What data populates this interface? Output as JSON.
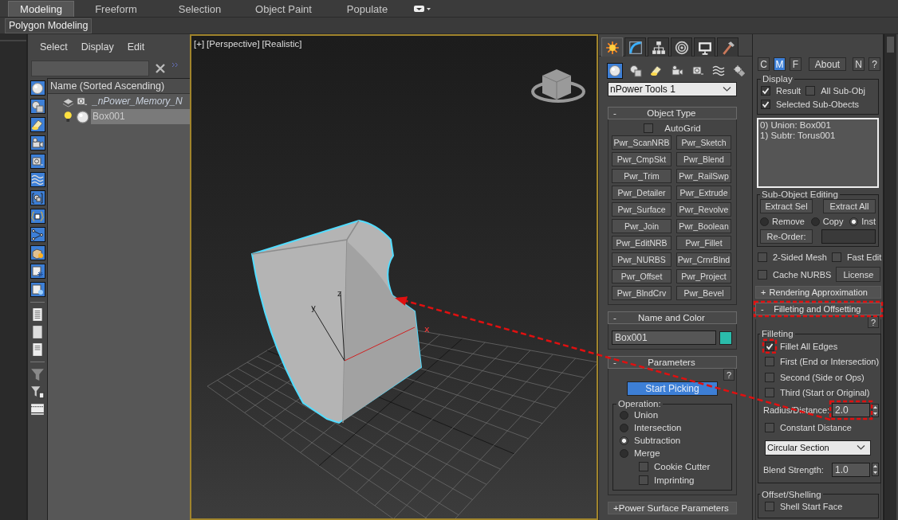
{
  "ribbon": {
    "tabs": [
      {
        "label": "Modeling",
        "selected": true
      },
      {
        "label": "Freeform",
        "selected": false
      },
      {
        "label": "Selection",
        "selected": false
      },
      {
        "label": "Object Paint",
        "selected": false
      },
      {
        "label": "Populate",
        "selected": false
      }
    ],
    "panel": "Polygon Modeling"
  },
  "scene_explorer": {
    "menus": [
      "Select",
      "Display",
      "Edit"
    ],
    "column_header": "Name (Sorted Ascending)",
    "items": [
      {
        "name": "_nPower_Memory_N",
        "kind": "layer",
        "selected": false
      },
      {
        "name": "Box001",
        "kind": "object",
        "selected": true
      }
    ]
  },
  "viewport": {
    "labels": [
      "[+]",
      "[Perspective]",
      "[Realistic]"
    ],
    "axis_labels": [
      "y",
      "z",
      "x"
    ]
  },
  "command_panel": {
    "tabs": [
      {
        "kind": "create",
        "selected": true
      },
      {
        "kind": "modify",
        "selected": false
      },
      {
        "kind": "hierarchy",
        "selected": false
      },
      {
        "kind": "motion",
        "selected": false
      },
      {
        "kind": "display",
        "selected": false
      },
      {
        "kind": "utilities",
        "selected": false
      }
    ],
    "categories": [
      {
        "kind": "geometry",
        "selected": true
      },
      {
        "kind": "shapes",
        "selected": false
      },
      {
        "kind": "lights",
        "selected": false
      },
      {
        "kind": "cameras",
        "selected": false
      },
      {
        "kind": "helpers",
        "selected": false
      },
      {
        "kind": "spacewarps",
        "selected": false
      },
      {
        "kind": "systems",
        "selected": false
      }
    ],
    "object_class": "nPower Tools 1",
    "object_type": {
      "toggle": "-",
      "title": "Object Type",
      "expanded": true,
      "autogrid": {
        "label": "AutoGrid",
        "checked": false
      },
      "buttons": [
        "Pwr_ScanNRB",
        "Pwr_Sketch",
        "Pwr_CmpSkt",
        "Pwr_Blend",
        "Pwr_Trim",
        "Pwr_RailSwp",
        "Pwr_Detailer",
        "Pwr_Extrude",
        "Pwr_Surface",
        "Pwr_Revolve",
        "Pwr_Join",
        "Pwr_Boolean",
        "Pwr_EditNRB",
        "Pwr_Fillet",
        "Pwr_NURBS",
        "Pwr_CrnrBlnd",
        "Pwr_Offset",
        "Pwr_Project",
        "Pwr_BlndCrv",
        "Pwr_Bevel"
      ]
    },
    "name_and_color": {
      "toggle": "-",
      "title": "Name and Color",
      "expanded": true,
      "name": "Box001",
      "color": "#2bbcab"
    },
    "parameters": {
      "toggle": "-",
      "title": "Parameters",
      "expanded": true,
      "help": "?",
      "pick_button": "Start Picking",
      "operation": {
        "label": "Operation:",
        "options": [
          {
            "label": "Union",
            "selected": false
          },
          {
            "label": "Intersection",
            "selected": false
          },
          {
            "label": "Subtraction",
            "selected": true
          },
          {
            "label": "Merge",
            "selected": false
          }
        ]
      },
      "options": [
        {
          "label": "Cookie Cutter",
          "checked": false
        },
        {
          "label": "Imprinting",
          "checked": false
        }
      ]
    },
    "power_surface": {
      "toggle": "+",
      "title": "Power Surface Parameters",
      "expanded": false
    }
  },
  "modifier_panel": {
    "buttons": [
      {
        "label": "C",
        "selected": false
      },
      {
        "label": "M",
        "selected": true
      },
      {
        "label": "F",
        "selected": false
      },
      {
        "label": "About",
        "selected": false
      },
      {
        "label": "N",
        "selected": false
      },
      {
        "label": "?",
        "selected": false
      }
    ],
    "display": {
      "label": "Display",
      "options": [
        {
          "label": "Result",
          "checked": true
        },
        {
          "label": "All Sub-Obj",
          "checked": false
        },
        {
          "label": "Selected Sub-Obects",
          "checked": true
        }
      ]
    },
    "operands": [
      "0) Union: Box001",
      "1) Subtr: Torus001"
    ],
    "sub_object_editing": {
      "label": "Sub-Object Editing",
      "extract_selected": "Extract Sel",
      "extract_all": "Extract All",
      "modes": [
        {
          "label": "Remove",
          "selected": false
        },
        {
          "label": "Copy",
          "selected": false
        },
        {
          "label": "Inst",
          "selected": true
        }
      ],
      "reorder": "Re-Order:"
    },
    "options": [
      {
        "label": "2-Sided Mesh",
        "checked": false
      },
      {
        "label": "Fast Edit",
        "checked": false
      },
      {
        "label": "Cache NURBS",
        "checked": false
      }
    ],
    "license": "License",
    "rendering": {
      "toggle": "+",
      "title": "Rendering Approximation",
      "expanded": false
    },
    "filleting_offsetting": {
      "toggle": "-",
      "title": "Filleting and Offsetting",
      "expanded": true,
      "help": "?",
      "filleting": {
        "label": "Filleting",
        "edges": [
          {
            "label": "Fillet All Edges",
            "checked": true
          },
          {
            "label": "First (End or Intersection)",
            "checked": false
          },
          {
            "label": "Second (Side or Ops)",
            "checked": false
          },
          {
            "label": "Third (Start or Original)",
            "checked": false
          }
        ],
        "radius_label": "Radius/Distance:",
        "radius": "2.0",
        "constant_distance": {
          "label": "Constant Distance",
          "checked": false
        },
        "section": "Circular Section",
        "blend_label": "Blend Strength:",
        "blend": "1.0"
      },
      "offset_shelling": {
        "label": "Offset/Shelling",
        "options": [
          {
            "label": "Shell Start Face",
            "checked": false
          }
        ]
      }
    }
  }
}
